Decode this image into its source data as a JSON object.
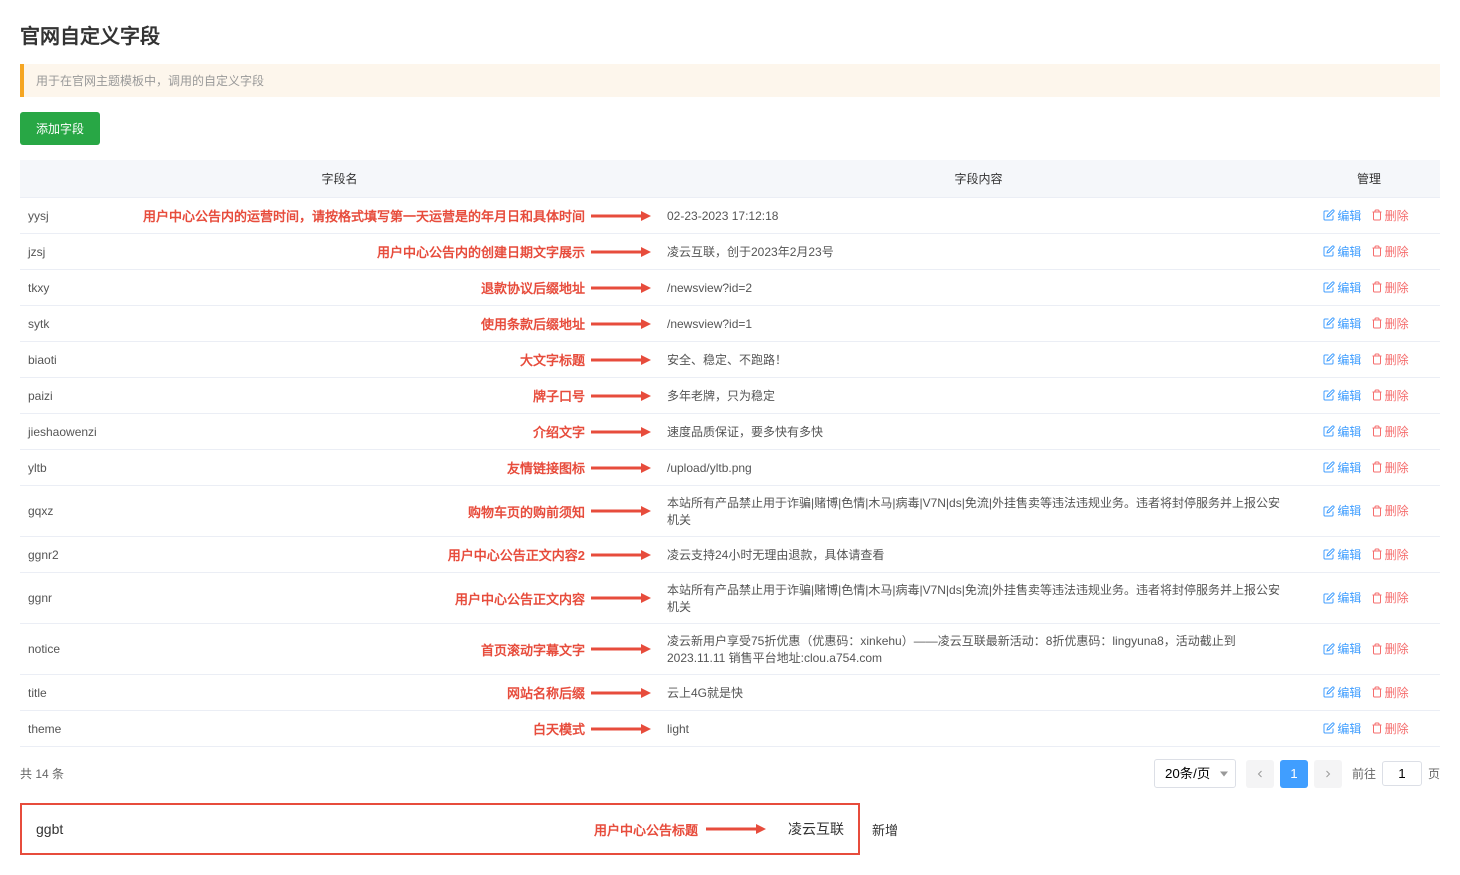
{
  "page": {
    "title": "官网自定义字段",
    "hint": "用于在官网主题模板中，调用的自定义字段",
    "add_button": "添加字段"
  },
  "table": {
    "headers": {
      "name": "字段名",
      "content": "字段内容",
      "actions": "管理"
    },
    "rows": [
      {
        "key": "yysj",
        "annotation": "用户中心公告内的运营时间，请按格式填写第一天运营是的年月日和具体时间",
        "content": "02-23-2023 17:12:18"
      },
      {
        "key": "jzsj",
        "annotation": "用户中心公告内的创建日期文字展示",
        "content": "凌云互联，创于2023年2月23号"
      },
      {
        "key": "tkxy",
        "annotation": "退款协议后缀地址",
        "content": "/newsview?id=2"
      },
      {
        "key": "sytk",
        "annotation": "使用条款后缀地址",
        "content": "/newsview?id=1"
      },
      {
        "key": "biaoti",
        "annotation": "大文字标题",
        "content": "安全、稳定、不跑路！"
      },
      {
        "key": "paizi",
        "annotation": "牌子口号",
        "content": "多年老牌，只为稳定"
      },
      {
        "key": "jieshaowenzi",
        "annotation": "介绍文字",
        "content": "速度品质保证，要多快有多快"
      },
      {
        "key": "yltb",
        "annotation": "友情链接图标",
        "content": "/upload/yltb.png"
      },
      {
        "key": "gqxz",
        "annotation": "购物车页的购前须知",
        "content": "本站所有产品禁止用于诈骗|赌博|色情|木马|病毒|V7N|ds|免流|外挂售卖等违法违规业务。违者将封停服务并上报公安机关"
      },
      {
        "key": "ggnr2",
        "annotation": "用户中心公告正文内容2",
        "content": "凌云支持24小时无理由退款，具体请查看"
      },
      {
        "key": "ggnr",
        "annotation": "用户中心公告正文内容",
        "content": "本站所有产品禁止用于诈骗|赌博|色情|木马|病毒|V7N|ds|免流|外挂售卖等违法违规业务。违者将封停服务并上报公安机关"
      },
      {
        "key": "notice",
        "annotation": "首页滚动字幕文字",
        "content": "凌云新用户享受75折优惠（优惠码：xinkehu）——凌云互联最新活动：8折优惠码：lingyuna8，活动截止到2023.11.11 销售平台地址:clou.a754.com"
      },
      {
        "key": "title",
        "annotation": "网站名称后缀",
        "content": "云上4G就是快"
      },
      {
        "key": "theme",
        "annotation": "白天模式",
        "content": "light"
      }
    ]
  },
  "actions": {
    "edit": "编辑",
    "delete": "删除"
  },
  "footer": {
    "total": "共 14 条",
    "page_size": "20条/页",
    "current_page": "1",
    "goto_prefix": "前往",
    "goto_value": "1",
    "goto_suffix": "页"
  },
  "bottom_row": {
    "key": "ggbt",
    "annotation": "用户中心公告标题",
    "content": "凌云互联",
    "new_label": "新增"
  }
}
